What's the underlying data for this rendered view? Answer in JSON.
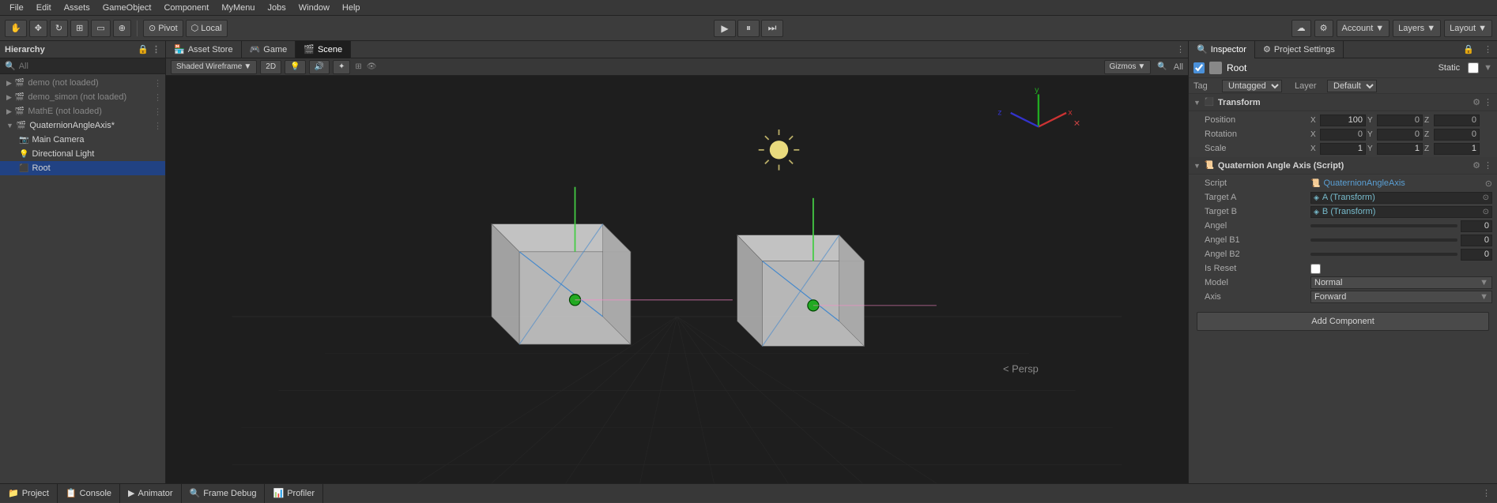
{
  "menubar": {
    "items": [
      "File",
      "Edit",
      "Assets",
      "GameObject",
      "Component",
      "MyMenu",
      "Jobs",
      "Window",
      "Help"
    ]
  },
  "toolbar": {
    "tools": [
      "hand",
      "move",
      "rotate",
      "scale",
      "rect",
      "transform"
    ],
    "pivot_label": "Pivot",
    "local_label": "Local",
    "play_btn": "▶",
    "pause_btn": "⏸",
    "step_btn": "⏭",
    "account_label": "Account",
    "layers_label": "Layers",
    "layout_label": "Layout",
    "collab_icon": "☁",
    "services_icon": "⚙"
  },
  "hierarchy": {
    "title": "Hierarchy",
    "search_placeholder": "All",
    "items": [
      {
        "name": "demo (not loaded)",
        "indent": 0,
        "arrow": "▶",
        "type": "scene",
        "grayed": true
      },
      {
        "name": "demo_simon (not loaded)",
        "indent": 0,
        "arrow": "▶",
        "type": "scene",
        "grayed": true
      },
      {
        "name": "MathE (not loaded)",
        "indent": 0,
        "arrow": "▶",
        "type": "scene",
        "grayed": true
      },
      {
        "name": "QuaternionAngleAxis*",
        "indent": 0,
        "arrow": "▼",
        "type": "scene",
        "grayed": false,
        "selected": false
      },
      {
        "name": "Main Camera",
        "indent": 1,
        "arrow": "",
        "type": "camera",
        "grayed": false
      },
      {
        "name": "Directional Light",
        "indent": 1,
        "arrow": "",
        "type": "light",
        "grayed": false
      },
      {
        "name": "Root",
        "indent": 1,
        "arrow": "",
        "type": "object",
        "grayed": false,
        "selected": true
      }
    ]
  },
  "scene_tabs": [
    {
      "label": "Asset Store",
      "icon": "🏪",
      "active": false
    },
    {
      "label": "Game",
      "icon": "🎮",
      "active": false
    },
    {
      "label": "Scene",
      "icon": "🎬",
      "active": true
    }
  ],
  "scene_toolbar": {
    "shading": "Shaded Wireframe",
    "mode_2d": "2D",
    "lighting_btn": "💡",
    "audio_btn": "🔊",
    "effects_btn": "✦",
    "gizmos_label": "Gizmos",
    "all_label": "All",
    "search_icon": "🔍"
  },
  "viewport": {
    "persp_label": "< Persp"
  },
  "inspector": {
    "title": "Inspector",
    "project_settings_label": "Project Settings",
    "object_name": "Root",
    "static_label": "Static",
    "tag_label": "Tag",
    "tag_value": "Untagged",
    "layer_label": "Layer",
    "layer_value": "Default",
    "transform": {
      "title": "Transform",
      "position_label": "Position",
      "rotation_label": "Rotation",
      "scale_label": "Scale",
      "pos_x": "100",
      "pos_y": "0",
      "pos_z": "0",
      "rot_x": "0",
      "rot_y": "0",
      "rot_z": "0",
      "scale_x": "1",
      "scale_y": "1",
      "scale_z": "1"
    },
    "script_component": {
      "title": "Quaternion Angle Axis (Script)",
      "script_label": "Script",
      "script_value": "QuaternionAngleAxis",
      "target_a_label": "Target A",
      "target_a_value": "A (Transform)",
      "target_b_label": "Target B",
      "target_b_value": "B (Transform)",
      "angel_label": "Angel",
      "angel_value": "0",
      "angel_b1_label": "Angel B1",
      "angel_b1_value": "0",
      "angel_b2_label": "Angel B2",
      "angel_b2_value": "0",
      "is_reset_label": "Is Reset",
      "model_label": "Model",
      "model_value": "Normal",
      "axis_label": "Axis",
      "axis_value": "Forward"
    },
    "add_component_label": "Add Component"
  },
  "bottom_tabs": [
    {
      "label": "Project",
      "icon": "📁",
      "active": false
    },
    {
      "label": "Console",
      "icon": "📋",
      "active": false
    },
    {
      "label": "Animator",
      "icon": "▶",
      "active": false
    },
    {
      "label": "Frame Debug",
      "icon": "🔍",
      "active": false
    },
    {
      "label": "Profiler",
      "icon": "📊",
      "active": false
    }
  ]
}
